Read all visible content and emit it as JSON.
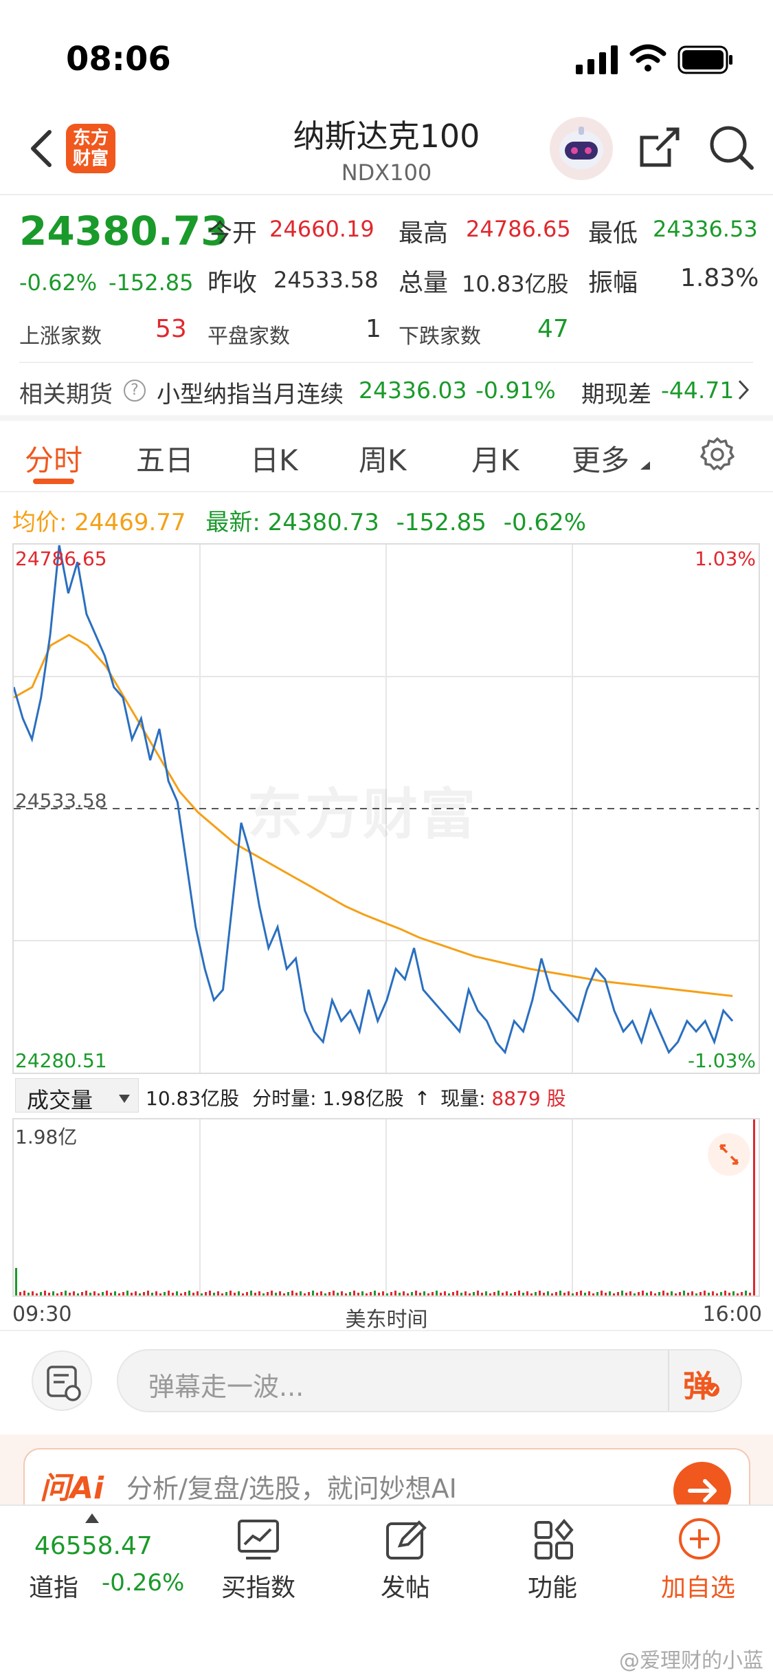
{
  "status_bar": {
    "time": "08:06"
  },
  "header": {
    "logo_text": "东方财富",
    "title": "纳斯达克100",
    "subtitle": "NDX100"
  },
  "quote": {
    "price": "24380.73",
    "change_pct": "-0.62%",
    "change": "-152.85",
    "open_label": "今开",
    "open": "24660.19",
    "high_label": "最高",
    "high": "24786.65",
    "low_label": "最低",
    "low": "24336.53",
    "prev_close_label": "昨收",
    "prev_close": "24533.58",
    "volume_label": "总量",
    "volume": "10.83亿股",
    "amplitude_label": "振幅",
    "amplitude": "1.83%",
    "up_label": "上涨家数",
    "up": "53",
    "flat_label": "平盘家数",
    "flat": "1",
    "down_label": "下跌家数",
    "down": "47"
  },
  "futures": {
    "label": "相关期货",
    "name": "小型纳指当月连续",
    "price": "24336.03",
    "pct": "-0.91%",
    "basis_label": "期现差",
    "basis": "-44.71"
  },
  "tabs": [
    "分时",
    "五日",
    "日K",
    "周K",
    "月K",
    "更多"
  ],
  "info_line": {
    "avg_label": "均价:",
    "avg": "24469.77",
    "latest_label": "最新:",
    "latest": "24380.73",
    "change": "-152.85",
    "pct": "-0.62%"
  },
  "chart_labels": {
    "top_price": "24786.65",
    "bottom_price": "24280.51",
    "ref_price": "24533.58",
    "top_pct": "1.03%",
    "bottom_pct": "-1.03%",
    "watermark": "东方财富"
  },
  "volume_bar": {
    "selector": "成交量",
    "total": "10.83亿股",
    "minute_label": "分时量:",
    "minute": "1.98亿股",
    "current_label": "现量:",
    "current": "8879",
    "current_unit": "股",
    "max_label": "1.98亿"
  },
  "time_axis": {
    "start": "09:30",
    "middle": "美东时间",
    "end": "16:00"
  },
  "comment": {
    "placeholder": "弹幕走一波...",
    "button": "弹"
  },
  "ai": {
    "logo": "问Ai",
    "text": "分析/复盘/选股，就问妙想AI"
  },
  "bottom_bar": {
    "index_value": "46558.47",
    "index_name": "道指",
    "index_pct": "-0.26%",
    "buy": "买指数",
    "post": "发帖",
    "function": "功能",
    "add": "加自选"
  },
  "watermark_user": "@爱理财的小蓝",
  "colors": {
    "up": "#e0282e",
    "down": "#1a9a2a",
    "accent": "#f0581e",
    "price_line": "#2a6fc0",
    "avg_line": "#f5a017"
  },
  "chart_data": {
    "type": "line",
    "ylim": [
      24280.51,
      24786.65
    ],
    "reference": 24533.58,
    "series": [
      {
        "name": "",
        "values": [
          24650,
          24620,
          24600,
          24640,
          24700,
          24786,
          24740,
          24770,
          24720,
          24700,
          24680,
          24650,
          24640,
          24600,
          24620,
          24580,
          24610,
          24560,
          24540,
          24480,
          24420,
          24380,
          24350,
          24360,
          24440,
          24520,
          24490,
          24440,
          24400,
          24420,
          24380,
          24390,
          24340,
          24320,
          24310,
          24350,
          24330,
          24340,
          24320,
          24360,
          24330,
          24350,
          24380,
          24370,
          24400,
          24360,
          24350,
          24340,
          24330,
          24320,
          24360,
          24340,
          24330,
          24310,
          24300,
          24330,
          24320,
          24350,
          24390,
          24360,
          24350,
          24340,
          24330,
          24360,
          24380,
          24370,
          24340,
          24320,
          24330,
          24310,
          24340,
          24320,
          24300,
          24310,
          24330,
          24320,
          24330,
          24310,
          24340,
          24330
        ]
      },
      {
        "name": "",
        "values": [
          24640,
          24650,
          24690,
          24700,
          24690,
          24670,
          24640,
          24610,
          24580,
          24550,
          24530,
          24515,
          24500,
          24490,
          24480,
          24470,
          24460,
          24450,
          24440,
          24432,
          24425,
          24418,
          24410,
          24404,
          24398,
          24392,
          24388,
          24384,
          24380,
          24377,
          24374,
          24371,
          24368,
          24366,
          24364,
          24362,
          24360,
          24358,
          24356,
          24354
        ]
      }
    ]
  }
}
